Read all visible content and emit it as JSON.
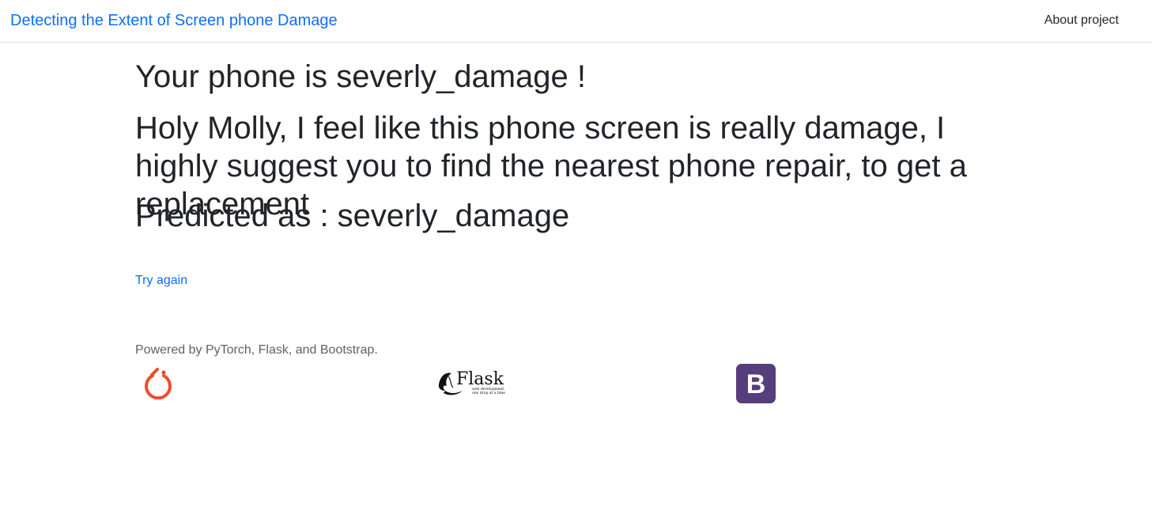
{
  "navbar": {
    "brand": "Detecting the Extent of Screen phone Damage",
    "about_link": "About project"
  },
  "result": {
    "heading": "Your phone is severly_damage !",
    "message": "Holy Molly, I feel like this phone screen is really damage, I highly suggest you to find the nearest phone repair, to get a replacement",
    "predicted": "Predicted as : severly_damage"
  },
  "actions": {
    "try_again": "Try again"
  },
  "footer": {
    "powered_by": "Powered by PyTorch, Flask, and Bootstrap.",
    "logos": [
      {
        "icon": "pytorch-logo",
        "color": "#ee4c2c"
      },
      {
        "icon": "flask-logo",
        "color": "#000000",
        "wordmark": "Flask",
        "tagline_1": "web development,",
        "tagline_2": "one drop at a time"
      },
      {
        "icon": "bootstrap-logo",
        "color": "#563d7c",
        "letter": "B"
      }
    ]
  },
  "colors": {
    "link": "#0d6efd",
    "text": "#212529",
    "muted": "#5c636a"
  }
}
